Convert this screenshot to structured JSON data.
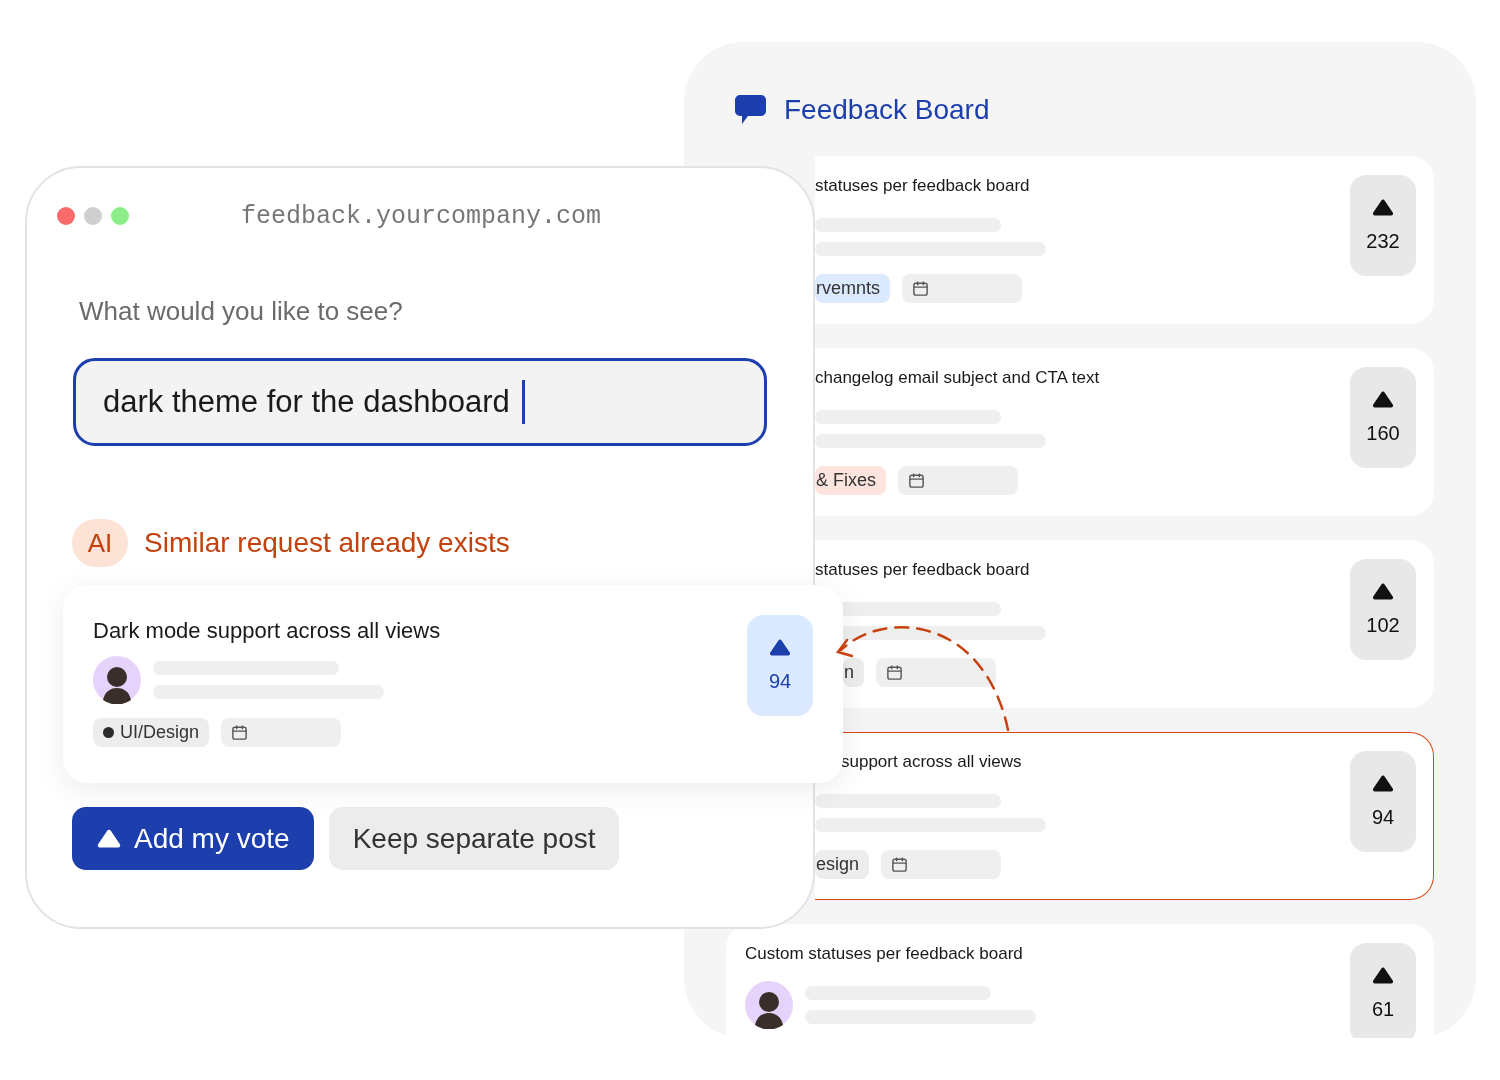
{
  "board": {
    "title": "Feedback Board",
    "posts": [
      {
        "kind": "covered",
        "title": "statuses per feedback board",
        "highlighted": false,
        "tag": {
          "label": "rvemnts",
          "color": "#dbeafe"
        },
        "votes": "232"
      },
      {
        "kind": "covered",
        "title": "changelog email subject and CTA text",
        "highlighted": false,
        "tag": {
          "label": "& Fixes",
          "color": "#fde4de"
        },
        "votes": "160"
      },
      {
        "kind": "covered",
        "title": "statuses per feedback board",
        "highlighted": false,
        "tag": {
          "label": "n",
          "color": "#ededed"
        },
        "votes": "102"
      },
      {
        "kind": "covered",
        "title": "support across all views",
        "highlighted": true,
        "tag": {
          "label": "esign",
          "color": "#ededed"
        },
        "votes": "94"
      },
      {
        "kind": "full",
        "title": "Custom statuses per feedback board",
        "highlighted": false,
        "votes": "61"
      }
    ]
  },
  "window": {
    "url": "feedback.yourcompany.com",
    "prompt": "What would you like to see?",
    "input": {
      "value": "dark theme for the dashboard"
    },
    "ai": {
      "badge": "AI",
      "message": "Similar request already exists"
    },
    "match": {
      "title": "Dark mode support across all views",
      "tag": {
        "label": "UI/Design",
        "color": "#ededed"
      },
      "votes": "94"
    },
    "buttons": [
      {
        "label": "Add my vote",
        "kind": "primary"
      },
      {
        "label": "Keep separate post",
        "kind": "secondary"
      }
    ]
  }
}
